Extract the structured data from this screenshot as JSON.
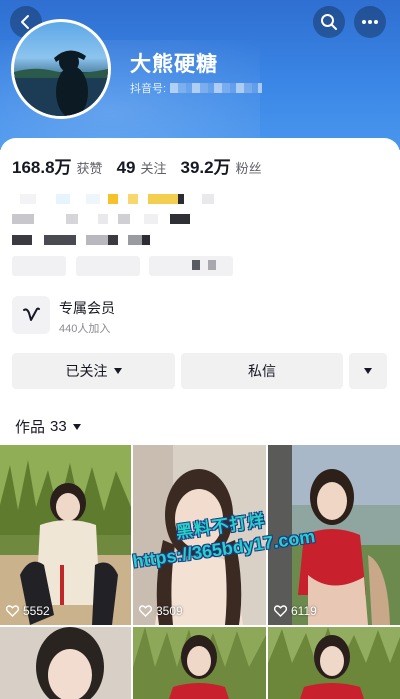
{
  "header": {
    "back_icon": "chevron-left-icon",
    "search_icon": "search-icon",
    "more_icon": "more-dots-icon",
    "accent_color": "#3a86e6"
  },
  "profile": {
    "nickname": "大熊硬糖",
    "douyin_id_label": "抖音号:"
  },
  "stats": [
    {
      "value": "168.8万",
      "label": "获赞"
    },
    {
      "value": "49",
      "label": "关注"
    },
    {
      "value": "39.2万",
      "label": "粉丝"
    }
  ],
  "membership": {
    "icon": "v-logo-icon",
    "title": "专属会员",
    "subtitle": "440人加入"
  },
  "actions": {
    "followed_label": "已关注",
    "message_label": "私信",
    "dropdown_icon": "caret-down-icon"
  },
  "works_tab": {
    "label": "作品",
    "count": "33"
  },
  "works": [
    {
      "likes": "5552"
    },
    {
      "likes": "3509"
    },
    {
      "likes": "6119"
    }
  ],
  "watermark": {
    "line1": "黑料不打烊",
    "line2": "https://365bdy17.com"
  }
}
